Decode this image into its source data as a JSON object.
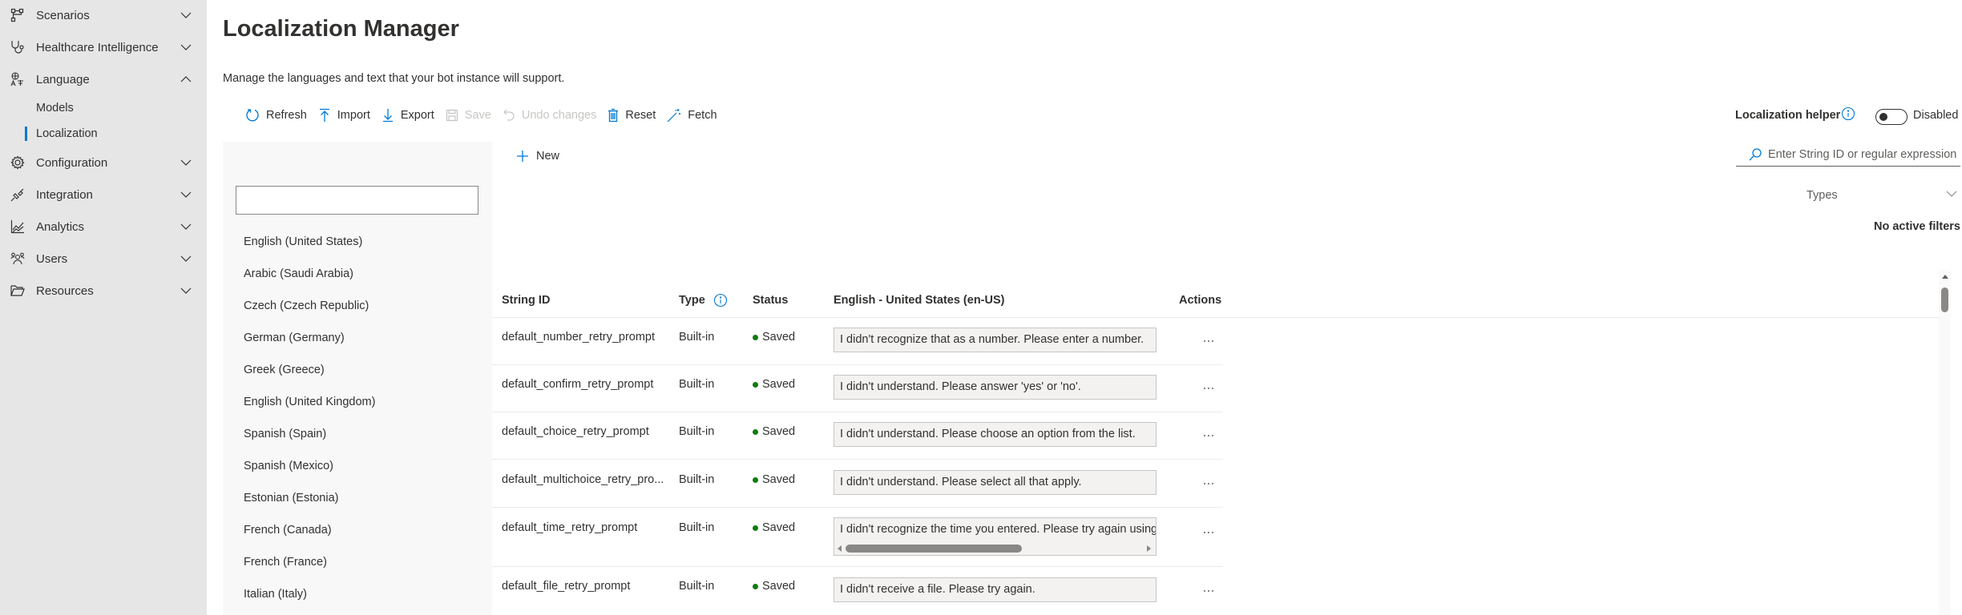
{
  "sidebar": {
    "items": [
      {
        "label": "Scenarios",
        "icon": "flow-icon",
        "expanded": false
      },
      {
        "label": "Healthcare Intelligence",
        "icon": "stethoscope-icon",
        "expanded": false
      },
      {
        "label": "Language",
        "icon": "translate-icon",
        "expanded": true
      },
      {
        "label": "Configuration",
        "icon": "gear-icon",
        "expanded": false
      },
      {
        "label": "Integration",
        "icon": "plug-icon",
        "expanded": false
      },
      {
        "label": "Analytics",
        "icon": "chart-icon",
        "expanded": false
      },
      {
        "label": "Users",
        "icon": "people-icon",
        "expanded": false
      },
      {
        "label": "Resources",
        "icon": "folder-icon",
        "expanded": false
      }
    ],
    "language_sub": [
      {
        "label": "Models",
        "active": false
      },
      {
        "label": "Localization",
        "active": true
      }
    ]
  },
  "page": {
    "title": "Localization Manager",
    "description": "Manage the languages and text that your bot instance will support."
  },
  "toolbar": {
    "refresh": "Refresh",
    "import": "Import",
    "export": "Export",
    "save": "Save",
    "undo": "Undo changes",
    "reset": "Reset",
    "fetch": "Fetch"
  },
  "languages": {
    "search_value": "",
    "items": [
      "English (United States)",
      "Arabic (Saudi Arabia)",
      "Czech (Czech Republic)",
      "German (Germany)",
      "Greek (Greece)",
      "English (United Kingdom)",
      "Spanish (Spain)",
      "Spanish (Mexico)",
      "Estonian (Estonia)",
      "French (Canada)",
      "French (France)",
      "Italian (Italy)"
    ]
  },
  "table": {
    "new_label": "New",
    "columns": {
      "string_id": "String ID",
      "type": "Type",
      "status": "Status",
      "english": "English - United States (en-US)",
      "actions": "Actions"
    },
    "rows": [
      {
        "string_id": "default_number_retry_prompt",
        "type": "Built-in",
        "status": "Saved",
        "text": "I didn't recognize that as a number. Please enter a number."
      },
      {
        "string_id": "default_confirm_retry_prompt",
        "type": "Built-in",
        "status": "Saved",
        "text": "I didn't understand. Please answer 'yes' or 'no'."
      },
      {
        "string_id": "default_choice_retry_prompt",
        "type": "Built-in",
        "status": "Saved",
        "text": "I didn't understand. Please choose an option from the list."
      },
      {
        "string_id": "default_multichoice_retry_pro...",
        "type": "Built-in",
        "status": "Saved",
        "text": "I didn't understand. Please select all that apply."
      },
      {
        "string_id": "default_time_retry_prompt",
        "type": "Built-in",
        "status": "Saved",
        "text": "I didn't recognize the time you entered. Please try again using a"
      },
      {
        "string_id": "default_file_retry_prompt",
        "type": "Built-in",
        "status": "Saved",
        "text": "I didn't receive a file. Please try again."
      }
    ]
  },
  "helper": {
    "label": "Localization helper",
    "state": "Disabled",
    "enabled": false
  },
  "filter": {
    "search_placeholder": "Enter String ID or regular expression",
    "types_label": "Types",
    "no_filters": "No active filters"
  },
  "colors": {
    "accent": "#0078d4",
    "saved": "#107c10",
    "sidebar_bg": "#e6e6e6"
  }
}
